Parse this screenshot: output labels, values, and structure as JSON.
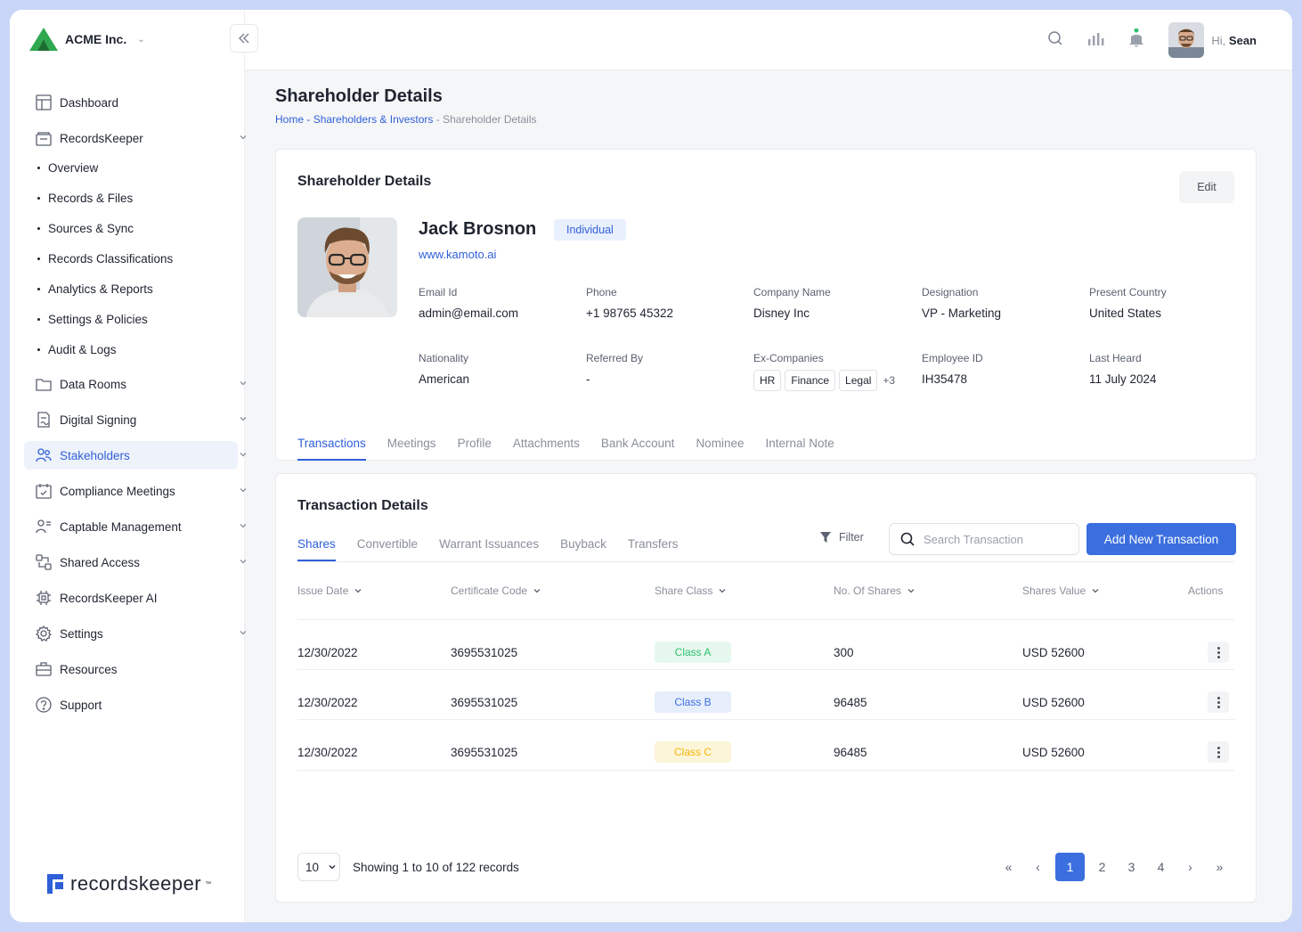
{
  "brand": {
    "name": "ACME Inc."
  },
  "sidebar": {
    "items": [
      {
        "label": "Dashboard"
      },
      {
        "label": "RecordsKeeper"
      },
      {
        "label": "Data Rooms"
      },
      {
        "label": "Digital Signing"
      },
      {
        "label": "Stakeholders"
      },
      {
        "label": "Compliance Meetings"
      },
      {
        "label": "Captable Management"
      },
      {
        "label": "Shared Access"
      },
      {
        "label": "RecordsKeeper AI"
      },
      {
        "label": "Settings"
      },
      {
        "label": "Resources"
      },
      {
        "label": "Support"
      }
    ],
    "sub_items": [
      {
        "label": "Overview"
      },
      {
        "label": "Records & Files"
      },
      {
        "label": "Sources & Sync"
      },
      {
        "label": "Records Classifications"
      },
      {
        "label": "Analytics & Reports"
      },
      {
        "label": "Settings & Policies"
      },
      {
        "label": "Audit & Logs"
      }
    ],
    "logo_text": "recordskeeper",
    "logo_tm": "™"
  },
  "topbar": {
    "greeting": "Hi,",
    "user": "Sean"
  },
  "page": {
    "title": "Shareholder Details",
    "breadcrumb": {
      "home": "Home",
      "sep": " - ",
      "parent": "Shareholders & Investors",
      "current": "Shareholder Details"
    }
  },
  "details": {
    "title": "Shareholder Details",
    "edit_label": "Edit",
    "name": "Jack Brosnon",
    "type_badge": "Individual",
    "website": "www.kamoto.ai",
    "fields": {
      "email": {
        "label": "Email Id",
        "value": "admin@email.com"
      },
      "phone": {
        "label": "Phone",
        "value": "+1 98765 45322"
      },
      "company": {
        "label": "Company Name",
        "value": "Disney Inc"
      },
      "designation": {
        "label": "Designation",
        "value": "VP - Marketing"
      },
      "country": {
        "label": "Present Country",
        "value": "United States"
      },
      "nationality": {
        "label": "Nationality",
        "value": "American"
      },
      "referred": {
        "label": "Referred By",
        "value": "-"
      },
      "ex_companies": {
        "label": "Ex-Companies",
        "chips": [
          "HR",
          "Finance",
          "Legal"
        ],
        "more": "+3"
      },
      "employee_id": {
        "label": "Employee ID",
        "value": "IH35478"
      },
      "last_heard": {
        "label": "Last Heard",
        "value": "11 July 2024"
      }
    },
    "tabs": [
      "Transactions",
      "Meetings",
      "Profile",
      "Attachments",
      "Bank Account",
      "Nominee",
      "Internal Note"
    ]
  },
  "transactions": {
    "title": "Transaction Details",
    "tabs": [
      "Shares",
      "Convertible",
      "Warrant Issuances",
      "Buyback",
      "Transfers"
    ],
    "filter_label": "Filter",
    "search_placeholder": "Search Transaction",
    "add_label": "Add New Transaction",
    "columns": [
      "Issue Date",
      "Certificate Code",
      "Share Class",
      "No. Of Shares",
      "Shares Value",
      "Actions"
    ],
    "rows": [
      {
        "date": "12/30/2022",
        "code": "3695531025",
        "class": "Class A",
        "shares": "300",
        "value": "USD 52600"
      },
      {
        "date": "12/30/2022",
        "code": "3695531025",
        "class": "Class B",
        "shares": "96485",
        "value": "USD 52600"
      },
      {
        "date": "12/30/2022",
        "code": "3695531025",
        "class": "Class C",
        "shares": "96485",
        "value": "USD 52600"
      }
    ],
    "per_page": "10",
    "showing": "Showing 1 to 10 of 122 records",
    "pages": [
      "1",
      "2",
      "3",
      "4"
    ]
  },
  "colors": {
    "accent": "#3b6fe0",
    "class_a": "#2fbf71",
    "class_b": "#3b6fe0",
    "class_c": "#f2b705"
  }
}
